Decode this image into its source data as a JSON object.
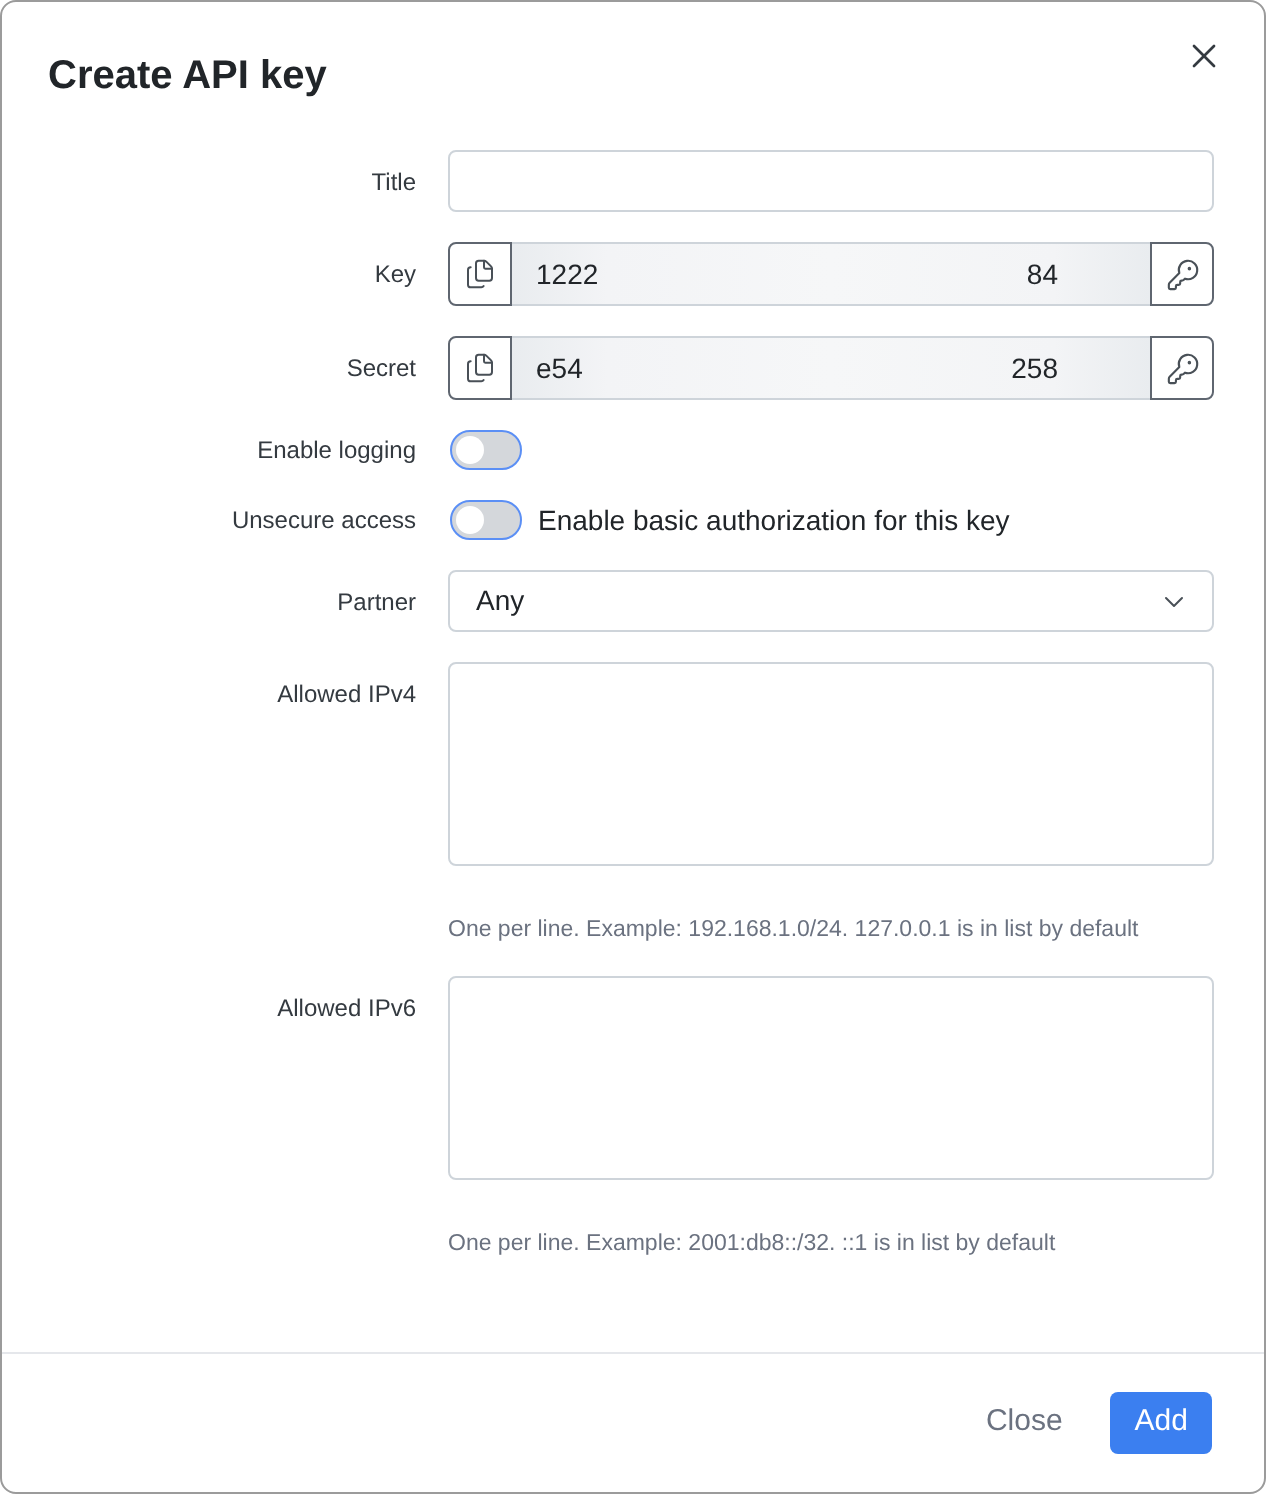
{
  "dialog": {
    "title": "Create API key"
  },
  "fields": [
    {
      "kind": "text",
      "label": "Title"
    },
    {
      "kind": "secret",
      "label": "Key",
      "value_start": "1222",
      "value_end": "84"
    },
    {
      "kind": "secret",
      "label": "Secret",
      "value_start": "e54",
      "value_end": "258"
    },
    {
      "kind": "toggle",
      "label": "Enable logging",
      "on": false
    },
    {
      "kind": "toggle",
      "label": "Unsecure access",
      "on": false,
      "caption": "Enable basic authorization for this key"
    },
    {
      "kind": "select",
      "label": "Partner",
      "value": "Any"
    },
    {
      "kind": "textarea",
      "label": "Allowed IPv4",
      "help": "One per line. Example: 192.168.1.0/24. 127.0.0.1 is in list by default"
    },
    {
      "kind": "textarea",
      "label": "Allowed IPv6",
      "help": "One per line. Example: 2001:db8::/32. ::1 is in list by default"
    }
  ],
  "buttons": [
    {
      "kind": "secondary",
      "label": "Close"
    },
    {
      "kind": "primary",
      "label": "Add"
    }
  ]
}
